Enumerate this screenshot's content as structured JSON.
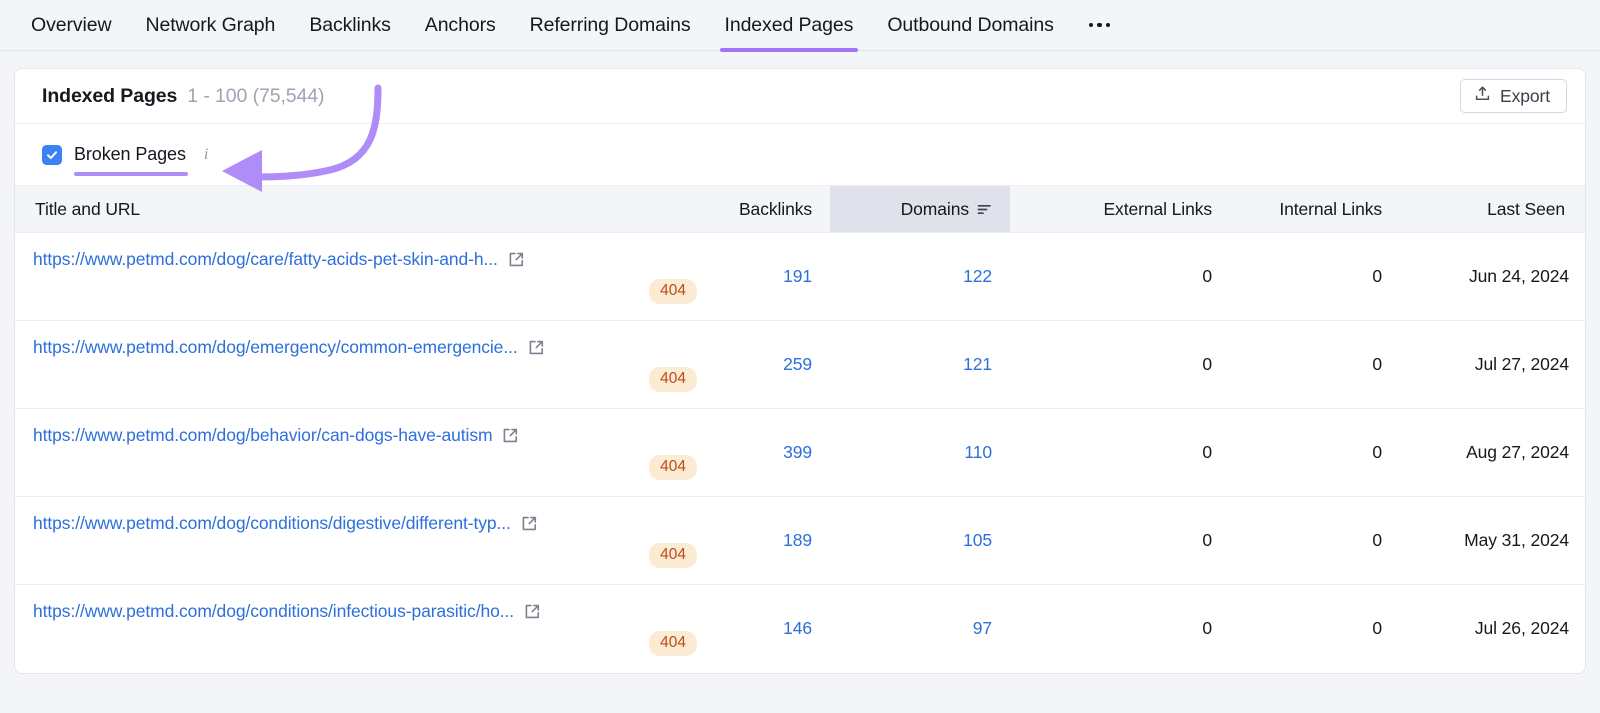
{
  "tabs": [
    {
      "label": "Overview",
      "active": false
    },
    {
      "label": "Network Graph",
      "active": false
    },
    {
      "label": "Backlinks",
      "active": false
    },
    {
      "label": "Anchors",
      "active": false
    },
    {
      "label": "Referring Domains",
      "active": false
    },
    {
      "label": "Indexed Pages",
      "active": true
    },
    {
      "label": "Outbound Domains",
      "active": false
    }
  ],
  "tab_overflow": "more-options",
  "card": {
    "title": "Indexed Pages",
    "count": "1 - 100 (75,544)",
    "export_label": "Export"
  },
  "filter": {
    "checkbox_label": "Broken Pages",
    "checkbox_checked": true,
    "info_glyph": "i"
  },
  "table": {
    "columns": [
      {
        "label": "Title and URL",
        "align": "left",
        "sorted": false
      },
      {
        "label": "Backlinks",
        "align": "right",
        "sorted": false
      },
      {
        "label": "Domains",
        "align": "right",
        "sorted": true,
        "sort_dir": "desc"
      },
      {
        "label": "External Links",
        "align": "right",
        "sorted": false
      },
      {
        "label": "Internal Links",
        "align": "right",
        "sorted": false
      },
      {
        "label": "Last Seen",
        "align": "right",
        "sorted": false
      }
    ],
    "rows": [
      {
        "url": "https://www.petmd.com/dog/care/fatty-acids-pet-skin-and-h...",
        "status": "404",
        "backlinks": "191",
        "domains": "122",
        "external_links": "0",
        "internal_links": "0",
        "last_seen": "Jun 24, 2024"
      },
      {
        "url": "https://www.petmd.com/dog/emergency/common-emergencie...",
        "status": "404",
        "backlinks": "259",
        "domains": "121",
        "external_links": "0",
        "internal_links": "0",
        "last_seen": "Jul 27, 2024"
      },
      {
        "url": "https://www.petmd.com/dog/behavior/can-dogs-have-autism",
        "status": "404",
        "backlinks": "399",
        "domains": "110",
        "external_links": "0",
        "internal_links": "0",
        "last_seen": "Aug 27, 2024"
      },
      {
        "url": "https://www.petmd.com/dog/conditions/digestive/different-typ...",
        "status": "404",
        "backlinks": "189",
        "domains": "105",
        "external_links": "0",
        "internal_links": "0",
        "last_seen": "May 31, 2024"
      },
      {
        "url": "https://www.petmd.com/dog/conditions/infectious-parasitic/ho...",
        "status": "404",
        "backlinks": "146",
        "domains": "97",
        "external_links": "0",
        "internal_links": "0",
        "last_seen": "Jul 26, 2024"
      }
    ]
  },
  "annotation": {
    "type": "curved-arrow",
    "color": "#b08cf8",
    "points_to": "info-icon"
  },
  "colors": {
    "accent_purple": "#a275f7",
    "link_blue": "#2d6fdb",
    "checkbox_blue": "#3b82f6",
    "badge_bg": "#fbebd2",
    "badge_text": "#bb4d17",
    "header_bg": "#f4f5f9",
    "sorted_col_bg": "#e0e2eb"
  }
}
